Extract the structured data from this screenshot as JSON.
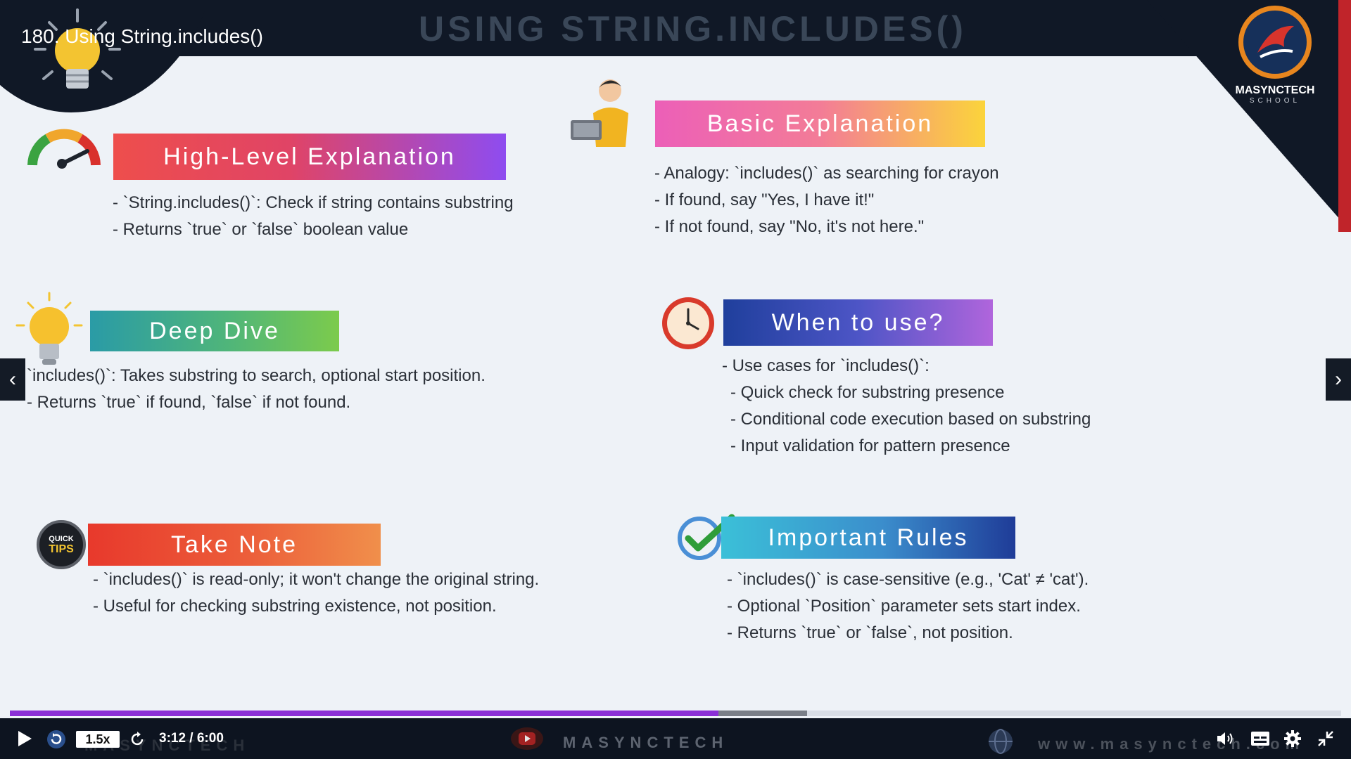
{
  "video": {
    "title": "180. Using String.includes()"
  },
  "slide": {
    "title": "USING STRING.INCLUDES()",
    "logo": {
      "name": "MASYNCTECH",
      "sub": "SCHOOL"
    },
    "sections": {
      "high_level": {
        "heading": "High-Level Explanation",
        "bullets": [
          "- `String.includes()`: Check if string contains substring",
          "- Returns `true` or `false` boolean value"
        ]
      },
      "basic": {
        "heading": "Basic Explanation",
        "bullets": [
          "- Analogy: `includes()` as searching for crayon",
          "- If found, say \"Yes, I have it!\"",
          "- If not found, say \"No, it's not here.\""
        ]
      },
      "deep_dive": {
        "heading": "Deep Dive",
        "bullets": [
          "`includes()`: Takes substring to search, optional start position.",
          "- Returns `true` if found, `false` if not found."
        ]
      },
      "when_to_use": {
        "heading": "When to use?",
        "bullets": [
          "- Use cases for `includes()`:",
          "  - Quick check for substring presence",
          "  - Conditional code execution based on substring",
          "  - Input validation for pattern presence"
        ]
      },
      "take_note": {
        "heading": "Take Note",
        "badge_line1": "QUICK",
        "badge_line2": "TIPS",
        "bullets": [
          "- `includes()` is read-only; it won't change the original string.",
          "- Useful for checking substring existence, not position."
        ]
      },
      "important_rules": {
        "heading": "Important Rules",
        "bullets": [
          "- `includes()` is case-sensitive (e.g., 'Cat' ≠ 'cat').",
          "- Optional `Position` parameter sets start index.",
          "- Returns `true` or `false`, not position."
        ]
      }
    }
  },
  "player": {
    "speed": "1.5x",
    "time": "3:12 / 6:00",
    "progress_fraction": 0.532,
    "buffered_fraction": 0.599,
    "watermark_left": "MASYNCTECH",
    "watermark_mid": "MASYNCTECH",
    "watermark_url": "www.masynctech.com"
  },
  "colors": {
    "progress": "#8b2fd6",
    "accent_red": "#c0242a",
    "background": "#eef2f7",
    "dark": "#101826"
  },
  "icons": [
    "lightbulb-icon",
    "gauge-icon",
    "person-laptop-icon",
    "clock-icon",
    "checkmark-icon",
    "quick-tips-badge-icon",
    "play-icon",
    "replay-icon",
    "forward-icon",
    "volume-icon",
    "captions-icon",
    "settings-icon",
    "exit-fullscreen-icon",
    "chevron-left-icon",
    "chevron-right-icon"
  ]
}
